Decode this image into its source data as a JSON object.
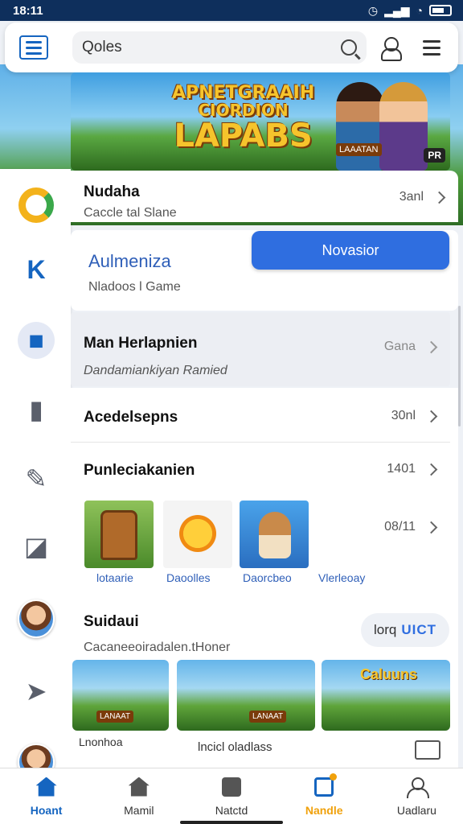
{
  "status_bar": {
    "time": "18:11"
  },
  "search": {
    "value": "Qoles"
  },
  "banner": {
    "title_line1": "APNETGRAAIH",
    "title_line2": "CIORDION",
    "title_line3": "LAPABS",
    "tag": "LAAATAN",
    "badge": "PR"
  },
  "featured": {
    "title": "Nudaha",
    "subtitle": "Caccle tal Slane",
    "meta": "3anl"
  },
  "promo": {
    "title": "Aulmeniza",
    "subtitle": "Nladoos l Game",
    "button_label": "Novasior"
  },
  "list_rows": [
    {
      "title": "Man Herlapnien",
      "subtitle": "Dandamiankiyan Ramied",
      "meta": "Gana"
    },
    {
      "title": "Acedelsepns",
      "subtitle": "",
      "meta": "30nl"
    },
    {
      "title": "Punleciakanien",
      "subtitle": "",
      "meta": "1401"
    }
  ],
  "thumbnails": {
    "meta": "08/11",
    "items": [
      {
        "label": "lotaarie",
        "icon": "totem-icon"
      },
      {
        "label": "Daoolles",
        "icon": "sun-icon"
      },
      {
        "label": "Daorcbeo",
        "icon": "fox-character-icon"
      },
      {
        "label": "Vlerleoay",
        "icon": ""
      }
    ]
  },
  "section": {
    "title": "Suidaui",
    "subtitle": "Cacaneeoiradalen.tHoner",
    "pill_prefix": "lorq",
    "pill_accent": "UICT",
    "tile_tag": "LANAAT",
    "tile_title": "Caluuns",
    "footer_left": "Lnonhoa",
    "footer_center": "lncicl oladlass"
  },
  "bottom_nav": [
    {
      "label": "Hoant",
      "icon": "home-icon"
    },
    {
      "label": "Mamil",
      "icon": "store-icon"
    },
    {
      "label": "Natctd",
      "icon": "grid-icon"
    },
    {
      "label": "Nandle",
      "icon": "edit-icon"
    },
    {
      "label": "Uadlaru",
      "icon": "profile-icon"
    }
  ],
  "colors": {
    "accent": "#2f6ee0",
    "brand": "#1565c0",
    "highlight": "#f0a10c",
    "status_bar": "#0e2f5c"
  }
}
